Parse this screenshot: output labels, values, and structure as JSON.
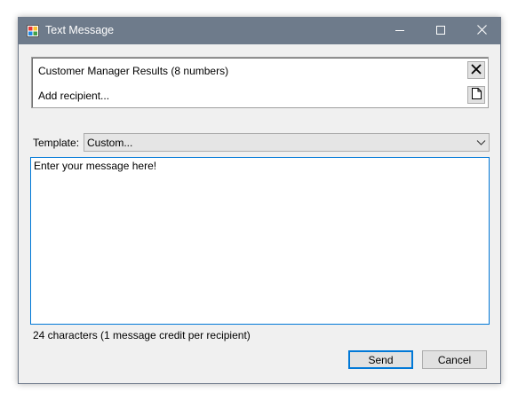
{
  "window": {
    "title": "Text Message"
  },
  "recipients": {
    "group_label": "Customer Manager Results (8 numbers)",
    "add_label": "Add recipient..."
  },
  "template": {
    "label": "Template:",
    "selected": "Custom..."
  },
  "message": {
    "text": "Enter your message here!"
  },
  "status": {
    "char_count": "24 characters (1 message credit per recipient)"
  },
  "buttons": {
    "send": "Send",
    "cancel": "Cancel"
  },
  "colors": {
    "titlebar": "#6e7b8b",
    "window_bg": "#f0f0f0",
    "focus_border": "#0078d7"
  },
  "icons": {
    "app": "app-icon",
    "minimize": "minimize-icon",
    "maximize": "maximize-icon",
    "close": "close-icon",
    "remove": "remove-recipient-icon",
    "new": "new-document-icon",
    "dropdown": "chevron-down-icon"
  }
}
